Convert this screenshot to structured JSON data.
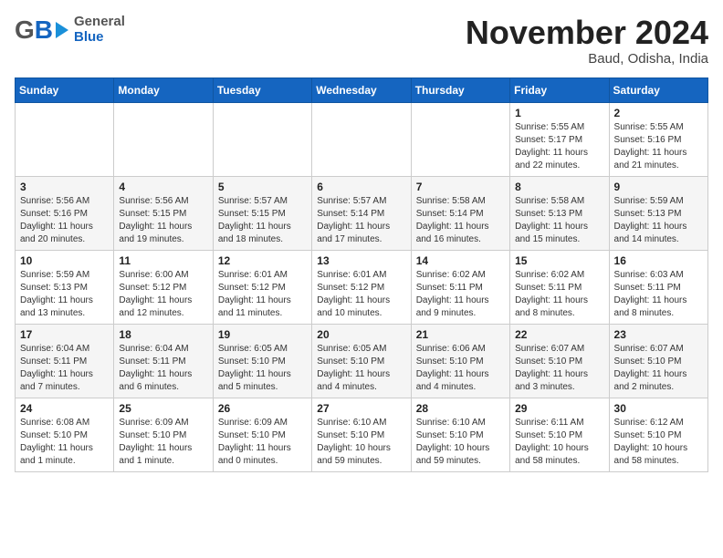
{
  "header": {
    "logo_general": "General",
    "logo_blue": "Blue",
    "month_title": "November 2024",
    "subtitle": "Baud, Odisha, India"
  },
  "weekdays": [
    "Sunday",
    "Monday",
    "Tuesday",
    "Wednesday",
    "Thursday",
    "Friday",
    "Saturday"
  ],
  "weeks": [
    [
      {
        "day": "",
        "info": ""
      },
      {
        "day": "",
        "info": ""
      },
      {
        "day": "",
        "info": ""
      },
      {
        "day": "",
        "info": ""
      },
      {
        "day": "",
        "info": ""
      },
      {
        "day": "1",
        "info": "Sunrise: 5:55 AM\nSunset: 5:17 PM\nDaylight: 11 hours\nand 22 minutes."
      },
      {
        "day": "2",
        "info": "Sunrise: 5:55 AM\nSunset: 5:16 PM\nDaylight: 11 hours\nand 21 minutes."
      }
    ],
    [
      {
        "day": "3",
        "info": "Sunrise: 5:56 AM\nSunset: 5:16 PM\nDaylight: 11 hours\nand 20 minutes."
      },
      {
        "day": "4",
        "info": "Sunrise: 5:56 AM\nSunset: 5:15 PM\nDaylight: 11 hours\nand 19 minutes."
      },
      {
        "day": "5",
        "info": "Sunrise: 5:57 AM\nSunset: 5:15 PM\nDaylight: 11 hours\nand 18 minutes."
      },
      {
        "day": "6",
        "info": "Sunrise: 5:57 AM\nSunset: 5:14 PM\nDaylight: 11 hours\nand 17 minutes."
      },
      {
        "day": "7",
        "info": "Sunrise: 5:58 AM\nSunset: 5:14 PM\nDaylight: 11 hours\nand 16 minutes."
      },
      {
        "day": "8",
        "info": "Sunrise: 5:58 AM\nSunset: 5:13 PM\nDaylight: 11 hours\nand 15 minutes."
      },
      {
        "day": "9",
        "info": "Sunrise: 5:59 AM\nSunset: 5:13 PM\nDaylight: 11 hours\nand 14 minutes."
      }
    ],
    [
      {
        "day": "10",
        "info": "Sunrise: 5:59 AM\nSunset: 5:13 PM\nDaylight: 11 hours\nand 13 minutes."
      },
      {
        "day": "11",
        "info": "Sunrise: 6:00 AM\nSunset: 5:12 PM\nDaylight: 11 hours\nand 12 minutes."
      },
      {
        "day": "12",
        "info": "Sunrise: 6:01 AM\nSunset: 5:12 PM\nDaylight: 11 hours\nand 11 minutes."
      },
      {
        "day": "13",
        "info": "Sunrise: 6:01 AM\nSunset: 5:12 PM\nDaylight: 11 hours\nand 10 minutes."
      },
      {
        "day": "14",
        "info": "Sunrise: 6:02 AM\nSunset: 5:11 PM\nDaylight: 11 hours\nand 9 minutes."
      },
      {
        "day": "15",
        "info": "Sunrise: 6:02 AM\nSunset: 5:11 PM\nDaylight: 11 hours\nand 8 minutes."
      },
      {
        "day": "16",
        "info": "Sunrise: 6:03 AM\nSunset: 5:11 PM\nDaylight: 11 hours\nand 8 minutes."
      }
    ],
    [
      {
        "day": "17",
        "info": "Sunrise: 6:04 AM\nSunset: 5:11 PM\nDaylight: 11 hours\nand 7 minutes."
      },
      {
        "day": "18",
        "info": "Sunrise: 6:04 AM\nSunset: 5:11 PM\nDaylight: 11 hours\nand 6 minutes."
      },
      {
        "day": "19",
        "info": "Sunrise: 6:05 AM\nSunset: 5:10 PM\nDaylight: 11 hours\nand 5 minutes."
      },
      {
        "day": "20",
        "info": "Sunrise: 6:05 AM\nSunset: 5:10 PM\nDaylight: 11 hours\nand 4 minutes."
      },
      {
        "day": "21",
        "info": "Sunrise: 6:06 AM\nSunset: 5:10 PM\nDaylight: 11 hours\nand 4 minutes."
      },
      {
        "day": "22",
        "info": "Sunrise: 6:07 AM\nSunset: 5:10 PM\nDaylight: 11 hours\nand 3 minutes."
      },
      {
        "day": "23",
        "info": "Sunrise: 6:07 AM\nSunset: 5:10 PM\nDaylight: 11 hours\nand 2 minutes."
      }
    ],
    [
      {
        "day": "24",
        "info": "Sunrise: 6:08 AM\nSunset: 5:10 PM\nDaylight: 11 hours\nand 1 minute."
      },
      {
        "day": "25",
        "info": "Sunrise: 6:09 AM\nSunset: 5:10 PM\nDaylight: 11 hours\nand 1 minute."
      },
      {
        "day": "26",
        "info": "Sunrise: 6:09 AM\nSunset: 5:10 PM\nDaylight: 11 hours\nand 0 minutes."
      },
      {
        "day": "27",
        "info": "Sunrise: 6:10 AM\nSunset: 5:10 PM\nDaylight: 10 hours\nand 59 minutes."
      },
      {
        "day": "28",
        "info": "Sunrise: 6:10 AM\nSunset: 5:10 PM\nDaylight: 10 hours\nand 59 minutes."
      },
      {
        "day": "29",
        "info": "Sunrise: 6:11 AM\nSunset: 5:10 PM\nDaylight: 10 hours\nand 58 minutes."
      },
      {
        "day": "30",
        "info": "Sunrise: 6:12 AM\nSunset: 5:10 PM\nDaylight: 10 hours\nand 58 minutes."
      }
    ]
  ]
}
